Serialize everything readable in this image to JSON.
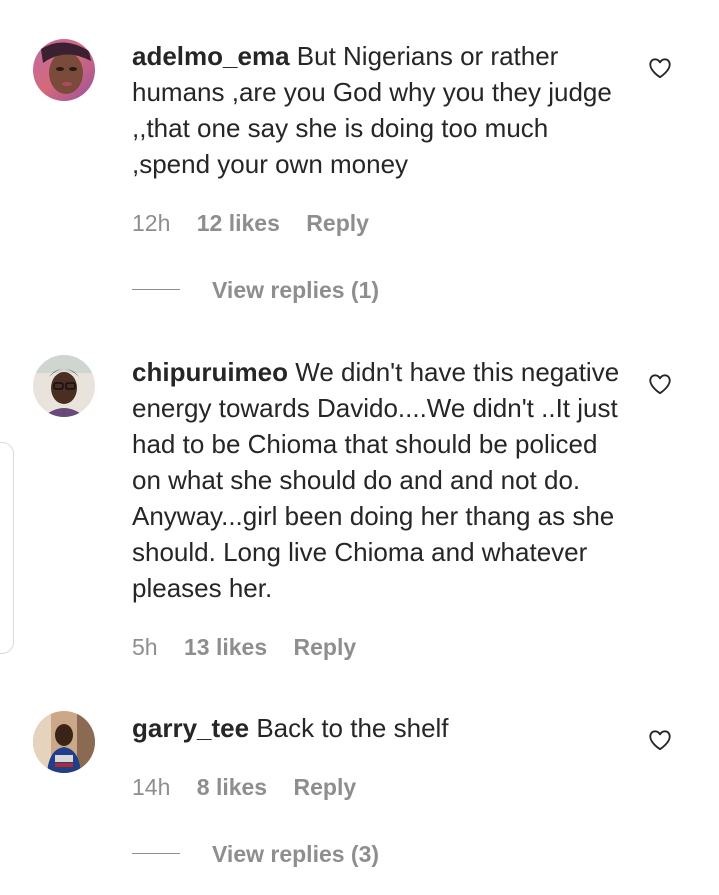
{
  "comments": [
    {
      "username": "adelmo_ema",
      "text": "But Nigerians or rather humans ,are you God why you they judge ,,that one say she is doing too much ,spend your own money",
      "time": "12h",
      "likes": "12 likes",
      "reply_label": "Reply",
      "view_replies": "View replies (1)"
    },
    {
      "username": "chipuruimeo",
      "text": "We didn't have this negative energy towards Davido....We didn't ..It just had to be Chioma that should be policed on what she should do and and not do. Anyway...girl been doing her thang as she should. Long live Chioma and whatever pleases her.",
      "time": "5h",
      "likes": "13 likes",
      "reply_label": "Reply"
    },
    {
      "username": "garry_tee",
      "text": "Back to the shelf",
      "time": "14h",
      "likes": "8 likes",
      "reply_label": "Reply",
      "view_replies": "View replies (3)"
    }
  ],
  "icons": {
    "like": "heart-outline-icon"
  },
  "colors": {
    "text": "#262626",
    "secondary": "#8e8e8e",
    "background": "#ffffff"
  }
}
